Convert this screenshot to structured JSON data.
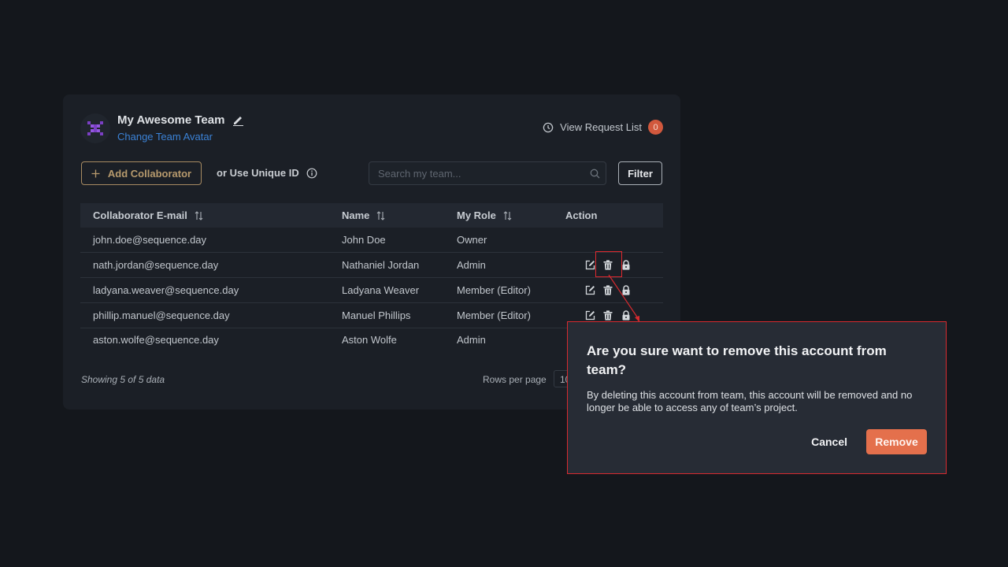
{
  "team": {
    "name": "My Awesome Team",
    "change_avatar_label": "Change Team Avatar"
  },
  "request_list": {
    "label": "View Request List",
    "count": "0"
  },
  "toolbar": {
    "add_collaborator_label": "Add Collaborator",
    "unique_id_label": "or Use Unique ID",
    "search_placeholder": "Search my team...",
    "filter_label": "Filter"
  },
  "table": {
    "headers": [
      "Collaborator E-mail",
      "Name",
      "My Role",
      "Action"
    ],
    "rows": [
      {
        "email": "john.doe@sequence.day",
        "name": "John Doe",
        "role": "Owner",
        "actions": false
      },
      {
        "email": "nath.jordan@sequence.day",
        "name": "Nathaniel Jordan",
        "role": "Admin",
        "actions": true
      },
      {
        "email": "ladyana.weaver@sequence.day",
        "name": "Ladyana Weaver",
        "role": "Member (Editor)",
        "actions": true
      },
      {
        "email": "phillip.manuel@sequence.day",
        "name": "Manuel Phillips",
        "role": "Member (Editor)",
        "actions": true
      },
      {
        "email": "aston.wolfe@sequence.day",
        "name": "Aston Wolfe",
        "role": "Admin",
        "actions": false
      }
    ]
  },
  "footer": {
    "showing_text": "Showing 5 of 5 data",
    "rows_per_page_label": "Rows per page",
    "rows_per_page_value": "10"
  },
  "modal": {
    "title": "Are you sure want to remove this account from team?",
    "description": "By deleting this account from team, this account will be removed and no longer be able to access any of team’s project.",
    "cancel_label": "Cancel",
    "remove_label": "Remove"
  },
  "colors": {
    "background": "#14171c",
    "card": "#1b1f26",
    "link": "#3b82d6",
    "accent_gold": "#b79a6d",
    "remove_button": "#e4704c",
    "badge": "#d1583d",
    "highlight": "#e0282e"
  },
  "icons": [
    "team-logo-icon",
    "edit-pencil-icon",
    "clock-icon",
    "plus-icon",
    "info-icon",
    "search-icon",
    "sort-icon",
    "edit-icon",
    "trash-icon",
    "lock-icon"
  ]
}
